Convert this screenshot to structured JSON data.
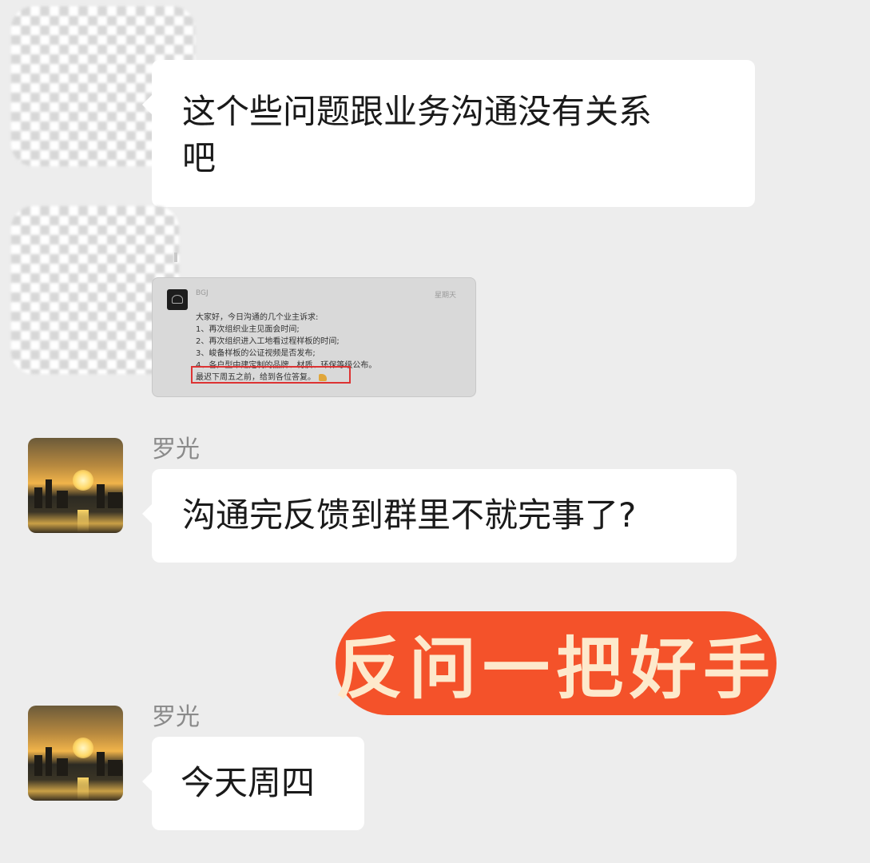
{
  "messages": [
    {
      "sender": "",
      "text_lines": [
        "这个些问题跟业务沟通没有关系",
        "吧"
      ]
    },
    {
      "sender": "",
      "image": {
        "name": "BGJ",
        "date": "星期天",
        "lines": [
          "大家好，今日沟通的几个业主诉求:",
          "1、再次组织业主见面会时间;",
          "2、再次组织进入工地看过程样板的时间;",
          "3、峻备样板的公证视频是否发布;",
          "4、各户型中建定制的品牌、材质、环保等级公布。",
          "最迟下周五之前，给到各位答复。"
        ],
        "icon": "folded-hands-icon"
      }
    },
    {
      "sender": "罗光",
      "text": "沟通完反馈到群里不就完事了?"
    },
    {
      "sender": "罗光",
      "text": "今天周四"
    }
  ],
  "sticker": {
    "text": "反问一把好手",
    "color": "#f4522a"
  }
}
